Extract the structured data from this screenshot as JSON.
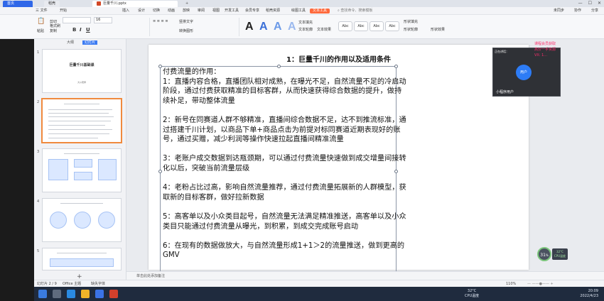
{
  "tabs": {
    "home": "首页",
    "docer": "稻壳",
    "document": "巨量千川.pptx",
    "new_tab": "+"
  },
  "menu": {
    "file": "三 文件",
    "items": [
      "开始",
      "插入",
      "设计",
      "切换",
      "动画",
      "放映",
      "审阅",
      "视图",
      "开发工具",
      "会员专享",
      "稻壳资源",
      "绘图工具",
      "文本工具"
    ],
    "active": "文本工具",
    "search": "查找命令、搜索模板",
    "right": [
      "未同步",
      "协作",
      "分享"
    ]
  },
  "ribbon": {
    "paste": "粘贴",
    "cut": "剪切",
    "copy": "复制",
    "format_painter": "格式刷",
    "font": "",
    "font_size": "16",
    "bold": "B",
    "italic": "I",
    "underline": "U",
    "text_fill": "文本填充",
    "text_outline": "文本轮廓",
    "text_effect": "文本效果",
    "shape_fill": "形状填充",
    "shape_outline": "形状轮廓",
    "shape_effect": "形状效果",
    "vertical_text": "竖排文字",
    "convert_smartart": "转换图形",
    "style_labels": [
      "Abc",
      "Abc",
      "Abc",
      "Abc"
    ],
    "big_letters": [
      "A",
      "A",
      "A",
      "A"
    ]
  },
  "left_panel": {
    "tab_outline": "大纲",
    "tab_slides": "幻灯片",
    "slide1_title": "巨量千川基础课",
    "slide1_sub": "大川老师",
    "slide_numbers": [
      "1",
      "2",
      "3",
      "4",
      "5"
    ]
  },
  "slide": {
    "title": "1：巨量千川的作用以及适用条件",
    "heading": "付费流量的作用：",
    "points": [
      "1：直播内容合格，直播团队相对成熟，在曝光不足，自然流量不足的冷启动阶段，通过付费获取精准的目标客群，从而快速获得综合数据的提升，做持续补足，带动整体流量",
      "2：新号在同赛道人群不够精准，直播间综合数据不足，达不到推流标准，通过搭建千川计划，以商品下单+商品点击为前提对标同赛道近期表现好的账号，通过买赠，减少利润等操作快速拉起直播间精准流量",
      "3：老账户成交数据到达瓶颈期，可以通过付费流量快速做到成交增量间接转化以后，突破当前流量层级",
      "4：老粉占比过高，影响自然流量推荐，通过付费流量拓展新的人群模型，获取新的目标客群，做好拉新数据",
      "5：高客单以及小众类目起号，自然流量无法满足精准推送，高客单以及小众类目只能通过付费流量从曝光，到积累，到成交完成账号启动",
      "6：在现有的数据做放大，与自然流量形成1+1＞2的流量推送，做到更高的GMV"
    ]
  },
  "notes_placeholder": "单击此处添加备注",
  "status": {
    "slide_counter": "幻灯片 2 / 9",
    "theme": "Office 主题",
    "font_missing": "缺失字体",
    "zoom": "110%"
  },
  "video": {
    "top_label": "正在讲话：",
    "avatar_text": "用户",
    "name": "小程序用户"
  },
  "overlay_text": [
    "课程会员获取",
    "高价一手资源",
    "VX: 1..."
  ],
  "cpu": {
    "percent": "31",
    "temp": "32°C",
    "label": "CPU温度"
  },
  "taskbar": {
    "weather_temp": "32°C",
    "weather_label": "CPU温度",
    "time": "20:09",
    "date": "2022/4/23"
  }
}
